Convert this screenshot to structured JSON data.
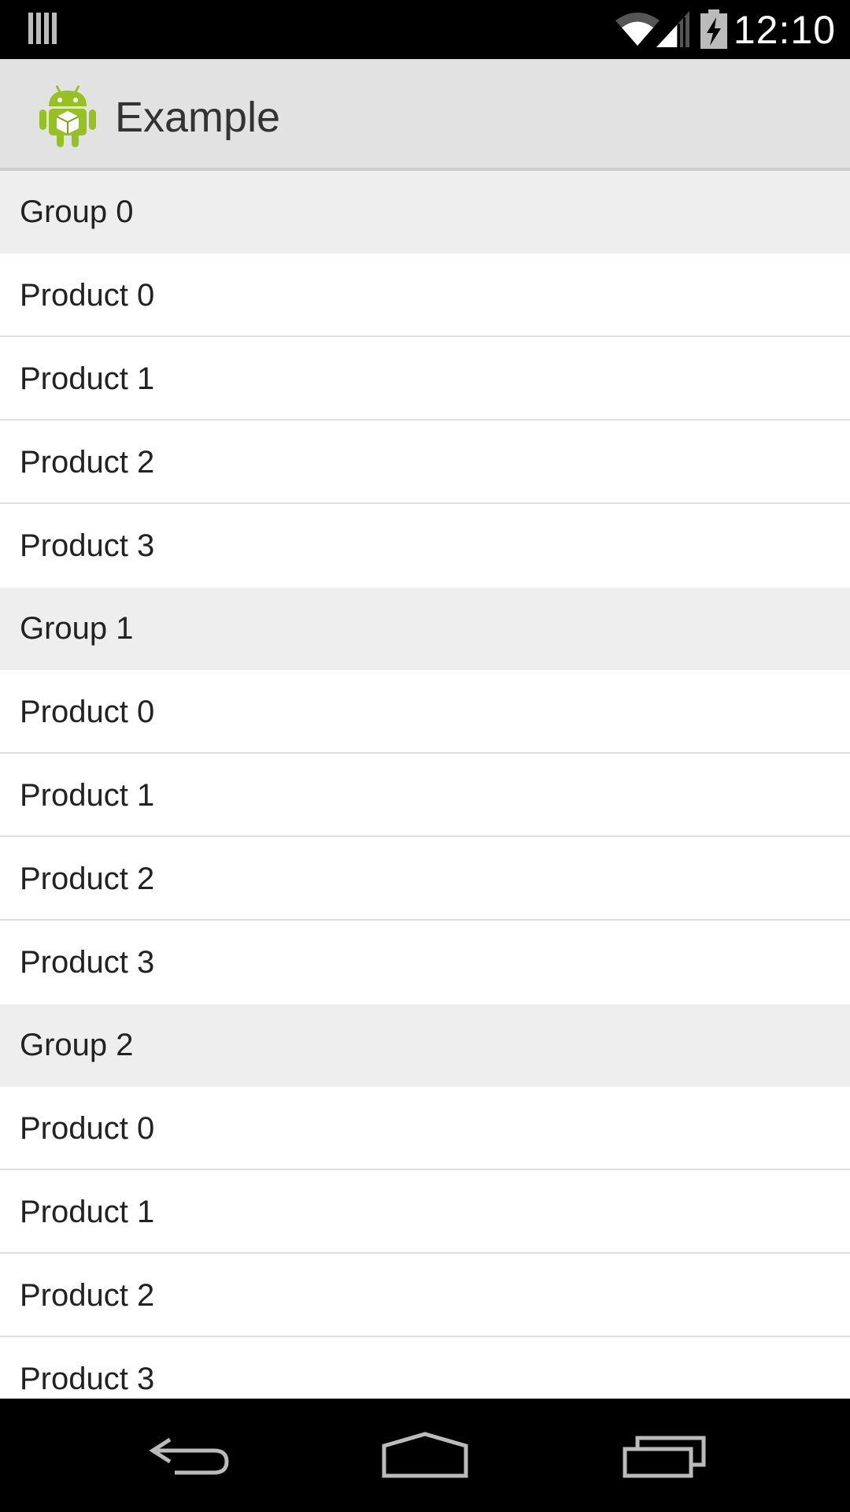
{
  "status_bar": {
    "time": "12:10",
    "left_icon": "notification-bars-icon",
    "wifi_icon": "wifi-icon",
    "signal_icon": "cell-signal-icon",
    "battery_icon": "battery-charging-icon"
  },
  "action_bar": {
    "title": "Example",
    "icon": "android-app-icon",
    "icon_color": "#97C024"
  },
  "list": {
    "groups": [
      {
        "label": "Group 0",
        "items": [
          "Product 0",
          "Product 1",
          "Product 2",
          "Product 3"
        ]
      },
      {
        "label": "Group 1",
        "items": [
          "Product 0",
          "Product 1",
          "Product 2",
          "Product 3"
        ]
      },
      {
        "label": "Group 2",
        "items": [
          "Product 0",
          "Product 1",
          "Product 2",
          "Product 3"
        ]
      }
    ]
  },
  "nav_bar": {
    "back_icon": "back-icon",
    "home_icon": "home-icon",
    "recents_icon": "recents-icon"
  },
  "colors": {
    "action_bar_bg": "#E2E2E2",
    "group_bg": "#EEEEEE",
    "item_bg": "#FFFFFF",
    "divider": "#DEDEDE",
    "text": "#222222"
  }
}
